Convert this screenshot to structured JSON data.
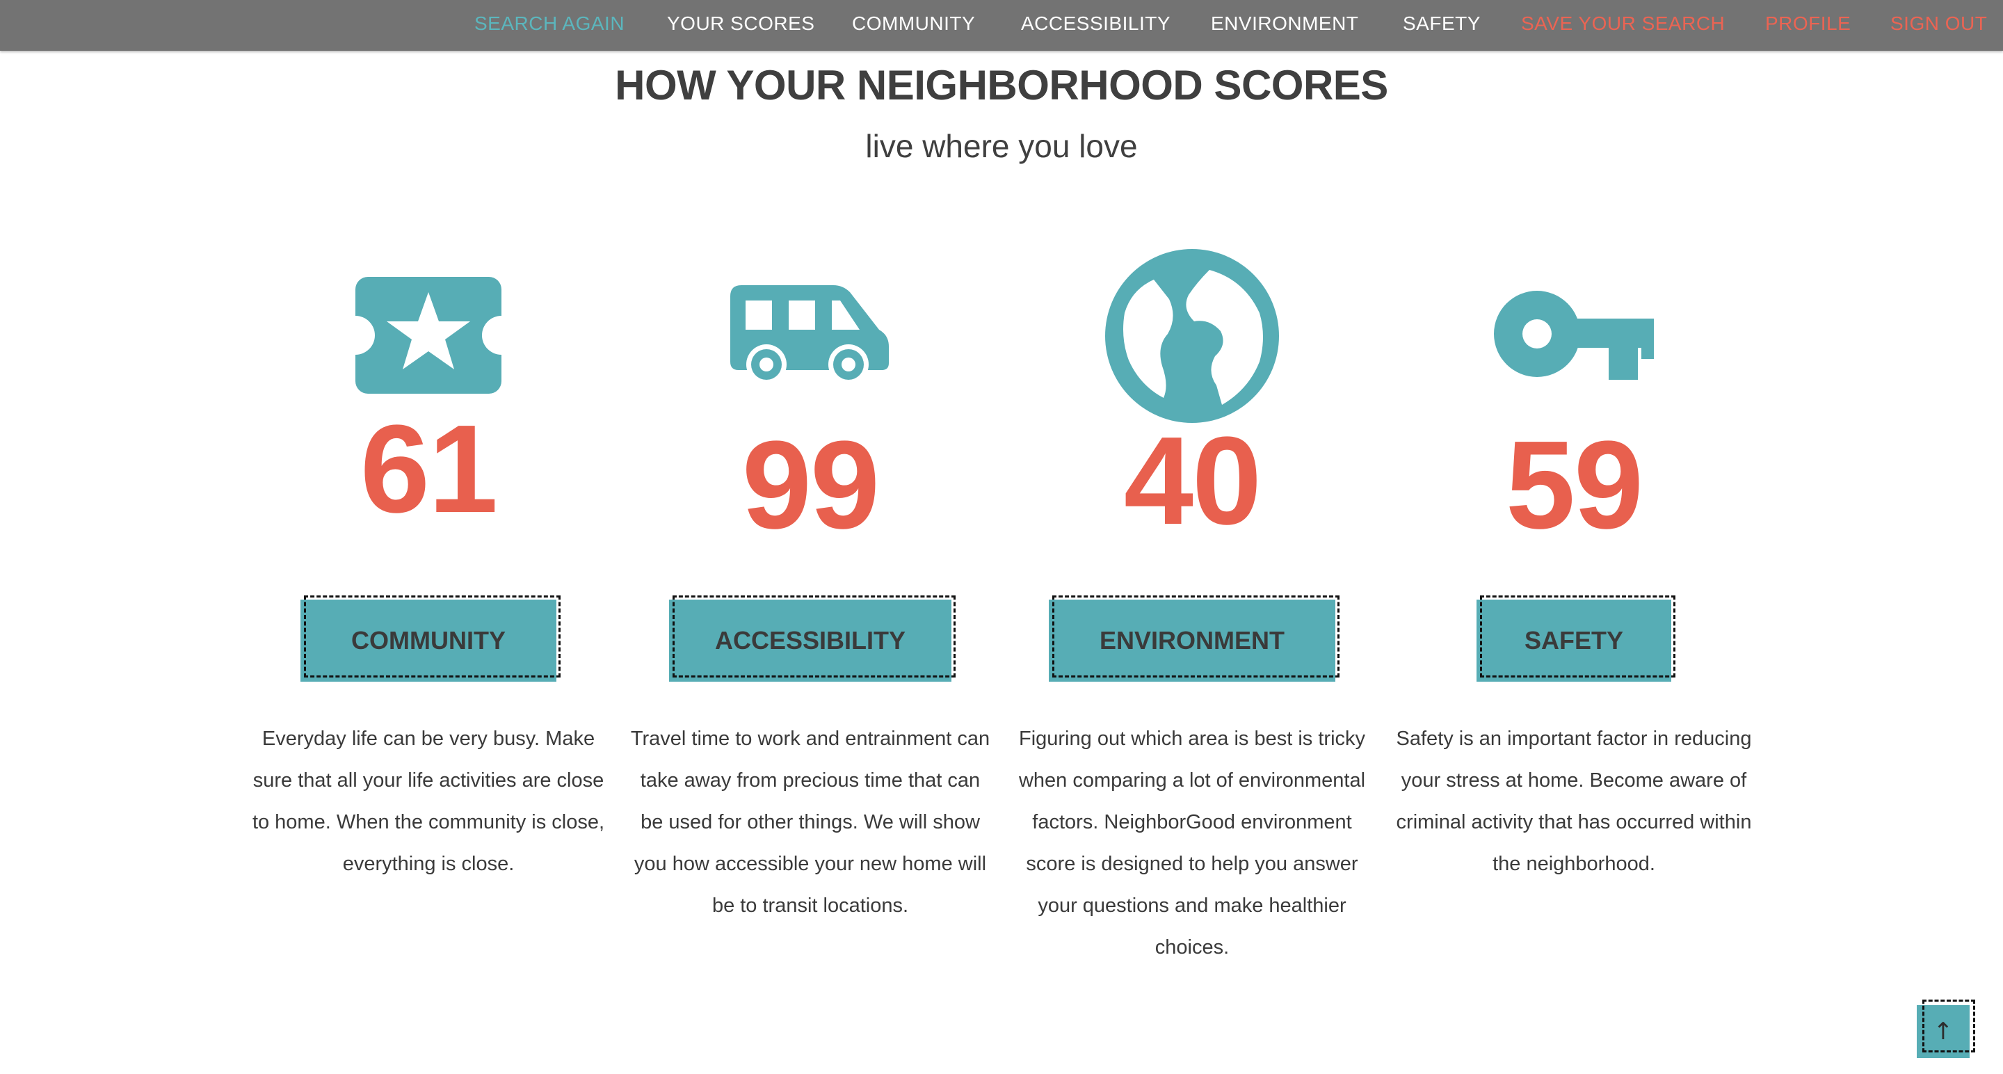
{
  "nav": {
    "items": [
      {
        "label": "SEARCH AGAIN",
        "color": "#5bb6bd"
      },
      {
        "label": "YOUR SCORES",
        "color": "#ffffff"
      },
      {
        "label": "COMMUNITY",
        "color": "#ffffff"
      },
      {
        "label": "ACCESSIBILITY",
        "color": "#ffffff"
      },
      {
        "label": "ENVIRONMENT",
        "color": "#ffffff"
      },
      {
        "label": "SAFETY",
        "color": "#ffffff"
      },
      {
        "label": "SAVE YOUR SEARCH",
        "color": "#eb6453"
      },
      {
        "label": "PROFILE",
        "color": "#eb6453"
      },
      {
        "label": "SIGN OUT",
        "color": "#eb6453"
      }
    ]
  },
  "header": {
    "title": "HOW YOUR NEIGHBORHOOD SCORES",
    "subtitle": "live where you love"
  },
  "categories": [
    {
      "icon": "ticket-star-icon",
      "score": "61",
      "button_label": "COMMUNITY",
      "description": "Everyday life can be very busy. Make sure that all your life activities are close to home. When the community is close, everything is close."
    },
    {
      "icon": "van-icon",
      "score": "99",
      "button_label": "ACCESSIBILITY",
      "description": "Travel time to work and entrainment can take away from precious time that can be used for other things. We will show you how accessible your new home will be to transit locations."
    },
    {
      "icon": "globe-icon",
      "score": "40",
      "button_label": "ENVIRONMENT",
      "description": "Figuring out which area is best is tricky when comparing a lot of environmental factors. NeighborGood environment score is designed to help you answer your questions and make healthier choices."
    },
    {
      "icon": "key-icon",
      "score": "59",
      "button_label": "SAFETY",
      "description": "Safety is an important factor in reducing your stress at home. Become aware of criminal activity that has occurred within the neighborhood."
    }
  ],
  "back_to_top": {
    "label": "↑",
    "icon": "arrow-up-icon"
  },
  "colors": {
    "accent_teal": "#57adb5",
    "score_coral": "#e8604e",
    "nav_bg": "#737373"
  }
}
